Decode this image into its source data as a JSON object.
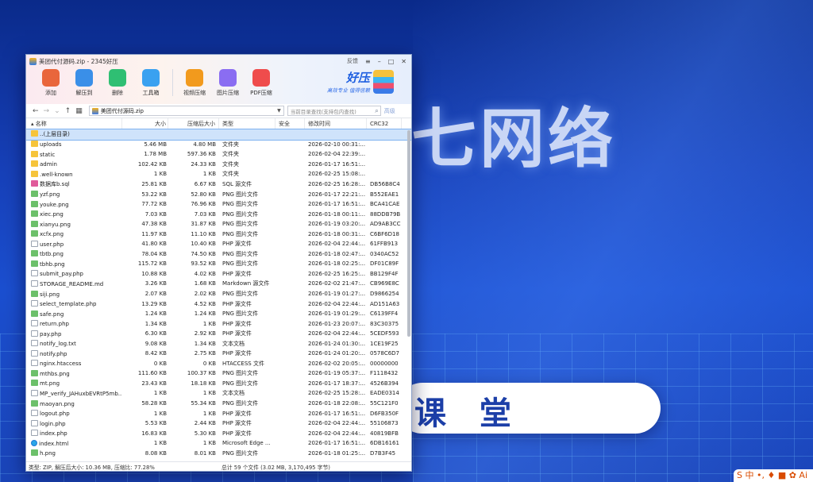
{
  "background": {
    "title": "七网络",
    "pill_text": "课 堂",
    "tray": "S 中 •, ♦ ■ ✿ Ai"
  },
  "window": {
    "title": "美团代付源码.zip - 2345好压",
    "feedback": "反馈",
    "menu_icon": "≡",
    "minimize": "–",
    "maximize": "□",
    "close": "✕",
    "toolbar": [
      {
        "label": "添加",
        "icon": "add-archive-icon",
        "color": "#e9663c"
      },
      {
        "label": "解压到",
        "icon": "extract-icon",
        "color": "#3a8fe8"
      },
      {
        "label": "删除",
        "icon": "recycle-icon",
        "color": "#2fbf73"
      },
      {
        "label": "工具箱",
        "icon": "toolbox-icon",
        "color": "#3aa1f0"
      },
      {
        "label": "视频压缩",
        "icon": "video-compress-icon",
        "color": "#f29a1d"
      },
      {
        "label": "图片压缩",
        "icon": "image-compress-icon",
        "color": "#8a6df2"
      },
      {
        "label": "PDF压缩",
        "icon": "pdf-compress-icon",
        "color": "#ef4c4c"
      }
    ],
    "brand": {
      "name": "好压",
      "slogan": "高效专业  值得信赖"
    },
    "path": "美团代付源码.zip",
    "search_placeholder": "当前目录查找(支持包内查找)",
    "search_button": "高级",
    "columns": {
      "name": "名称",
      "size": "大小",
      "csize": "压缩后大小",
      "type": "类型",
      "security": "安全",
      "mtime": "修改时间",
      "crc": "CRC32"
    },
    "files": [
      {
        "name": "..(上层目录)",
        "size": "",
        "csize": "",
        "type": "",
        "mtime": "",
        "crc": "",
        "icon": "folder"
      },
      {
        "name": "uploads",
        "size": "5.46 MB",
        "csize": "4.80 MB",
        "type": "文件夹",
        "mtime": "2026-02-10 00:31:...",
        "crc": "",
        "icon": "folder"
      },
      {
        "name": "static",
        "size": "1.78 MB",
        "csize": "597.36 KB",
        "type": "文件夹",
        "mtime": "2026-02-04 22:39:...",
        "crc": "",
        "icon": "folder"
      },
      {
        "name": "admin",
        "size": "102.42 KB",
        "csize": "24.33 KB",
        "type": "文件夹",
        "mtime": "2026-01-17 16:51:...",
        "crc": "",
        "icon": "folder"
      },
      {
        "name": ".well-known",
        "size": "1 KB",
        "csize": "1 KB",
        "type": "文件夹",
        "mtime": "2026-02-25 15:08:...",
        "crc": "",
        "icon": "folder"
      },
      {
        "name": "数据库b.sql",
        "size": "25.81 KB",
        "csize": "6.67 KB",
        "type": "SQL 源文件",
        "mtime": "2026-02-25 16:28:...",
        "crc": "DB56B8C4",
        "icon": "db"
      },
      {
        "name": "yzf.png",
        "size": "53.22 KB",
        "csize": "52.80 KB",
        "type": "PNG 图片文件",
        "mtime": "2026-01-17 22:21:...",
        "crc": "B552EAE1",
        "icon": "image"
      },
      {
        "name": "youke.png",
        "size": "77.72 KB",
        "csize": "76.96 KB",
        "type": "PNG 图片文件",
        "mtime": "2026-01-17 16:51:...",
        "crc": "BCA41CAE",
        "icon": "image"
      },
      {
        "name": "xiec.png",
        "size": "7.03 KB",
        "csize": "7.03 KB",
        "type": "PNG 图片文件",
        "mtime": "2026-01-18 00:11:...",
        "crc": "88DDB79B",
        "icon": "image"
      },
      {
        "name": "xianyu.png",
        "size": "47.38 KB",
        "csize": "31.87 KB",
        "type": "PNG 图片文件",
        "mtime": "2026-01-19 03:20:...",
        "crc": "AD9AB3CC",
        "icon": "image"
      },
      {
        "name": "xcfx.png",
        "size": "11.97 KB",
        "csize": "11.10 KB",
        "type": "PNG 图片文件",
        "mtime": "2026-01-18 00:31:...",
        "crc": "C6BF6D18",
        "icon": "image"
      },
      {
        "name": "user.php",
        "size": "41.80 KB",
        "csize": "10.40 KB",
        "type": "PHP 源文件",
        "mtime": "2026-02-04 22:44:...",
        "crc": "61FFB913",
        "icon": "file"
      },
      {
        "name": "tbtb.png",
        "size": "78.04 KB",
        "csize": "74.50 KB",
        "type": "PNG 图片文件",
        "mtime": "2026-01-18 02:47:...",
        "crc": "0340AC52",
        "icon": "image"
      },
      {
        "name": "tbhb.png",
        "size": "115.72 KB",
        "csize": "93.52 KB",
        "type": "PNG 图片文件",
        "mtime": "2026-01-18 02:25:...",
        "crc": "DF01C89F",
        "icon": "image"
      },
      {
        "name": "submit_pay.php",
        "size": "10.88 KB",
        "csize": "4.02 KB",
        "type": "PHP 源文件",
        "mtime": "2026-02-25 16:25:...",
        "crc": "BB129F4F",
        "icon": "file"
      },
      {
        "name": "STORAGE_README.md",
        "size": "3.26 KB",
        "csize": "1.68 KB",
        "type": "Markdown 源文件",
        "mtime": "2026-02-02 21:47:...",
        "crc": "CB969E8C",
        "icon": "file"
      },
      {
        "name": "siji.png",
        "size": "2.07 KB",
        "csize": "2.02 KB",
        "type": "PNG 图片文件",
        "mtime": "2026-01-19 01:27:...",
        "crc": "D9866254",
        "icon": "image"
      },
      {
        "name": "select_template.php",
        "size": "13.29 KB",
        "csize": "4.52 KB",
        "type": "PHP 源文件",
        "mtime": "2026-02-04 22:44:...",
        "crc": "AD151A63",
        "icon": "file"
      },
      {
        "name": "safe.png",
        "size": "1.24 KB",
        "csize": "1.24 KB",
        "type": "PNG 图片文件",
        "mtime": "2026-01-19 01:29:...",
        "crc": "C6139FF4",
        "icon": "image"
      },
      {
        "name": "return.php",
        "size": "1.34 KB",
        "csize": "1 KB",
        "type": "PHP 源文件",
        "mtime": "2026-01-23 20:07:...",
        "crc": "83C30375",
        "icon": "file"
      },
      {
        "name": "pay.php",
        "size": "6.30 KB",
        "csize": "2.92 KB",
        "type": "PHP 源文件",
        "mtime": "2026-02-04 22:44:...",
        "crc": "5CEDF593",
        "icon": "file"
      },
      {
        "name": "notify_log.txt",
        "size": "9.08 KB",
        "csize": "1.34 KB",
        "type": "文本文档",
        "mtime": "2026-01-24 01:30:...",
        "crc": "1CE19F25",
        "icon": "file"
      },
      {
        "name": "notify.php",
        "size": "8.42 KB",
        "csize": "2.75 KB",
        "type": "PHP 源文件",
        "mtime": "2026-01-24 01:20:...",
        "crc": "0578C6D7",
        "icon": "file"
      },
      {
        "name": "nginx.htaccess",
        "size": "0 KB",
        "csize": "0 KB",
        "type": "HTACCESS 文件",
        "mtime": "2026-02-02 20:05:...",
        "crc": "00000000",
        "icon": "file"
      },
      {
        "name": "mthbs.png",
        "size": "111.60 KB",
        "csize": "100.37 KB",
        "type": "PNG 图片文件",
        "mtime": "2026-01-19 05:37:...",
        "crc": "F1118432",
        "icon": "image"
      },
      {
        "name": "mt.png",
        "size": "23.43 KB",
        "csize": "18.18 KB",
        "type": "PNG 图片文件",
        "mtime": "2026-01-17 18:37:...",
        "crc": "4526B394",
        "icon": "image"
      },
      {
        "name": "MP_verify_JAHuxbEVRtP5mb...",
        "size": "1 KB",
        "csize": "1 KB",
        "type": "文本文档",
        "mtime": "2026-02-25 15:28:...",
        "crc": "EADE0314",
        "icon": "file"
      },
      {
        "name": "maoyan.png",
        "size": "58.28 KB",
        "csize": "55.34 KB",
        "type": "PNG 图片文件",
        "mtime": "2026-01-18 22:08:...",
        "crc": "55C121F0",
        "icon": "image"
      },
      {
        "name": "logout.php",
        "size": "1 KB",
        "csize": "1 KB",
        "type": "PHP 源文件",
        "mtime": "2026-01-17 16:51:...",
        "crc": "D6FB350F",
        "icon": "file"
      },
      {
        "name": "login.php",
        "size": "5.53 KB",
        "csize": "2.44 KB",
        "type": "PHP 源文件",
        "mtime": "2026-02-04 22:44:...",
        "crc": "55106873",
        "icon": "file"
      },
      {
        "name": "index.php",
        "size": "16.83 KB",
        "csize": "5.30 KB",
        "type": "PHP 源文件",
        "mtime": "2026-02-04 22:44:...",
        "crc": "40819BFB",
        "icon": "file"
      },
      {
        "name": "index.html",
        "size": "1 KB",
        "csize": "1 KB",
        "type": "Microsoft Edge ...",
        "mtime": "2026-01-17 16:51:...",
        "crc": "6DB16161",
        "icon": "html"
      },
      {
        "name": "h.png",
        "size": "8.08 KB",
        "csize": "8.01 KB",
        "type": "PNG 图片文件",
        "mtime": "2026-01-18 01:25:...",
        "crc": "D7B3F45",
        "icon": "image"
      }
    ],
    "status_left": "类型: ZIP, 解压后大小: 10.36 MB, 压缩比: 77.28%",
    "status_mid": "总计 59 个文件 (3.02 MB, 3,170,495 字节)"
  }
}
